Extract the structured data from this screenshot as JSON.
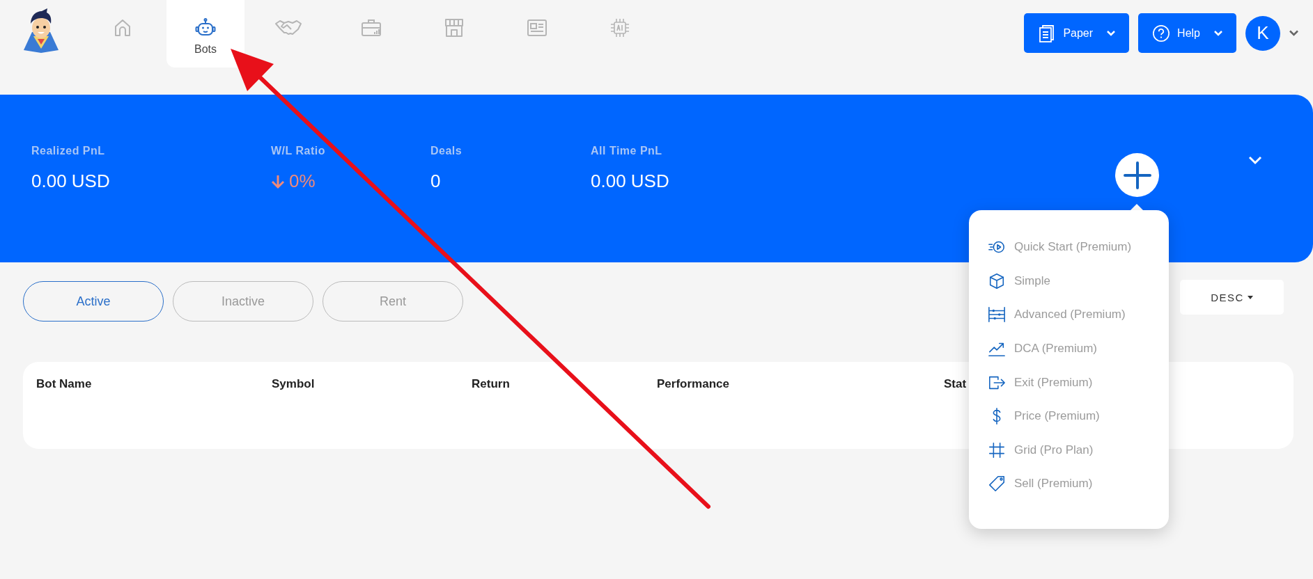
{
  "nav": {
    "items": [
      {
        "kind": "home",
        "selected": false
      },
      {
        "kind": "robot",
        "label": "Bots",
        "selected": true
      },
      {
        "kind": "handshake",
        "selected": false
      },
      {
        "kind": "briefcase",
        "selected": false
      },
      {
        "kind": "store",
        "selected": false
      },
      {
        "kind": "news",
        "selected": false
      },
      {
        "kind": "chip",
        "selected": false
      }
    ]
  },
  "header_buttons": [
    {
      "kind": "paper",
      "label": "Paper"
    },
    {
      "kind": "help",
      "label": "Help"
    }
  ],
  "avatar": {
    "initial": "K"
  },
  "summary": {
    "stats": [
      {
        "label": "Realized PnL",
        "value": "0.00 USD",
        "down": false
      },
      {
        "label": "W/L Ratio",
        "value": "0%",
        "down": true
      },
      {
        "label": "Deals",
        "value": "0",
        "down": false
      },
      {
        "label": "All Time PnL",
        "value": "0.00 USD",
        "down": false
      }
    ]
  },
  "create_menu": {
    "items": [
      {
        "kind": "quick",
        "label": "Quick Start (Premium)"
      },
      {
        "kind": "cube",
        "label": "Simple"
      },
      {
        "kind": "sliders",
        "label": "Advanced (Premium)"
      },
      {
        "kind": "chart",
        "label": "DCA (Premium)"
      },
      {
        "kind": "exit",
        "label": "Exit (Premium)"
      },
      {
        "kind": "dollar",
        "label": "Price (Premium)"
      },
      {
        "kind": "grid",
        "label": "Grid (Pro Plan)"
      },
      {
        "kind": "tag",
        "label": "Sell (Premium)"
      }
    ]
  },
  "filter_tabs": [
    {
      "label": "Active",
      "selected": true
    },
    {
      "label": "Inactive",
      "selected": false
    },
    {
      "label": "Rent",
      "selected": false
    }
  ],
  "sort": {
    "label": "DESC"
  },
  "table": {
    "columns": [
      "Bot Name",
      "Symbol",
      "Return",
      "Performance",
      "Stat"
    ]
  }
}
